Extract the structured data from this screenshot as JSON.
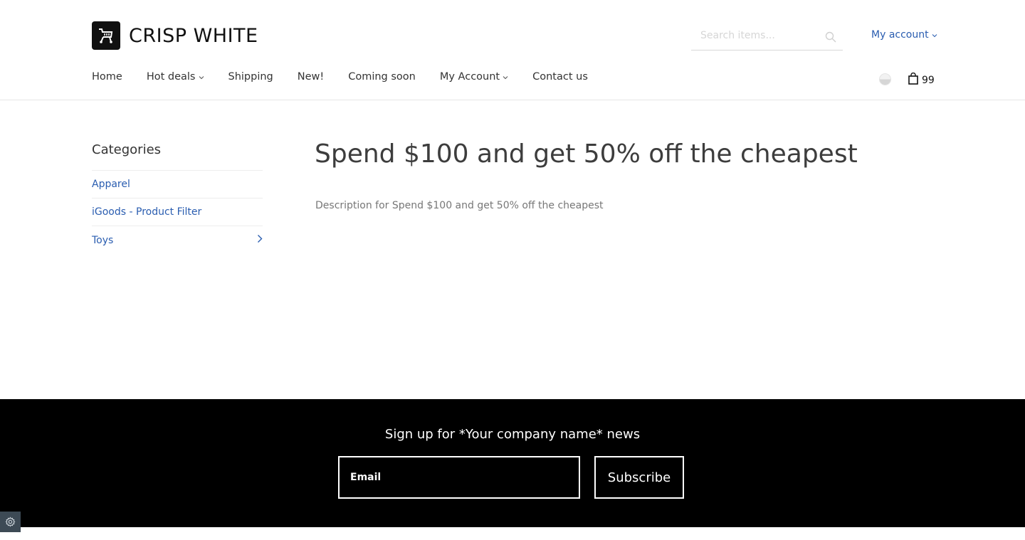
{
  "header": {
    "brand": "CRISP WHITE",
    "logo_icon": "shop-cart-logo",
    "search_placeholder": "Search items...",
    "account_label": "My account",
    "cart_count": "99"
  },
  "nav": {
    "items": [
      {
        "label": "Home"
      },
      {
        "label": "Hot deals"
      },
      {
        "label": "Shipping"
      },
      {
        "label": "New!"
      },
      {
        "label": "Coming soon"
      },
      {
        "label": "My Account"
      },
      {
        "label": "Contact us"
      }
    ]
  },
  "sidebar": {
    "title": "Categories",
    "items": [
      {
        "label": "Apparel"
      },
      {
        "label": "iGoods - Product Filter"
      },
      {
        "label": "Toys"
      }
    ]
  },
  "main": {
    "title": "Spend $100 and get 50% off the cheapest",
    "description": "Description for Spend $100 and get 50% off the cheapest"
  },
  "footer": {
    "signup_title": "Sign up for *Your company name* news",
    "email_placeholder": "Email",
    "subscribe_label": "Subscribe"
  },
  "colors": {
    "link": "#2a5db0",
    "footer_bg": "#000000",
    "text": "#333333"
  }
}
